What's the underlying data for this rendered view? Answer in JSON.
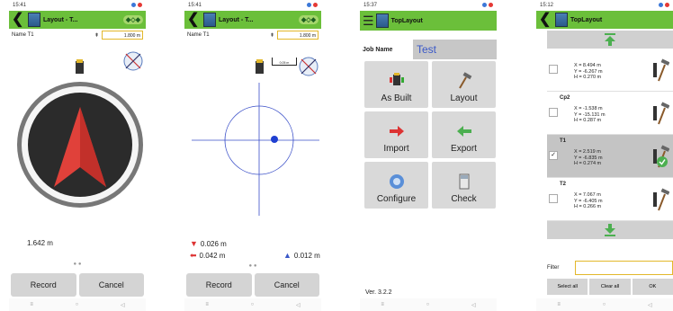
{
  "screen1": {
    "time": "15:41",
    "title": "Layout - T...",
    "name_label": "Name T1",
    "height_value": "1.800 m",
    "distance": "1.642 m",
    "record": "Record",
    "cancel": "Cancel"
  },
  "screen2": {
    "time": "15:41",
    "title": "Layout - T...",
    "name_label": "Name T1",
    "height_value": "1.800 m",
    "scale": "0.05 m",
    "down_value": "0.026 m",
    "left_value": "0.042 m",
    "up_value": "0.012 m",
    "record": "Record",
    "cancel": "Cancel"
  },
  "screen3": {
    "time": "15:37",
    "title": "TopLayout",
    "job_label": "Job Name",
    "job_value": "Test",
    "tiles": [
      "As Built",
      "Layout",
      "Import",
      "Export",
      "Configure",
      "Check"
    ],
    "version": "Ver. 3.2.2"
  },
  "screen4": {
    "time": "15:12",
    "title": "TopLayout",
    "rows": [
      {
        "name": "",
        "x": "X = 8.494 m",
        "y": "Y = -6.267 m",
        "h": "H = 0.270 m",
        "checked": "",
        "selected": false
      },
      {
        "name": "Cp2",
        "x": "X = -1.538 m",
        "y": "Y = -15.131 m",
        "h": "H = 0.287 m",
        "checked": "",
        "selected": false
      },
      {
        "name": "T1",
        "x": "X = 2.519 m",
        "y": "Y = -6.835 m",
        "h": "H = 0.274 m",
        "checked": "✓",
        "selected": true
      },
      {
        "name": "T2",
        "x": "X = 7.067 m",
        "y": "Y = -6.405 m",
        "h": "H = 0.266 m",
        "checked": "",
        "selected": false
      }
    ],
    "filter_label": "Filter",
    "select_all": "Select all",
    "clear_all": "Clear all",
    "ok": "OK"
  },
  "nav_icons": [
    "menu-icon",
    "home-icon",
    "back-triangle-icon"
  ]
}
